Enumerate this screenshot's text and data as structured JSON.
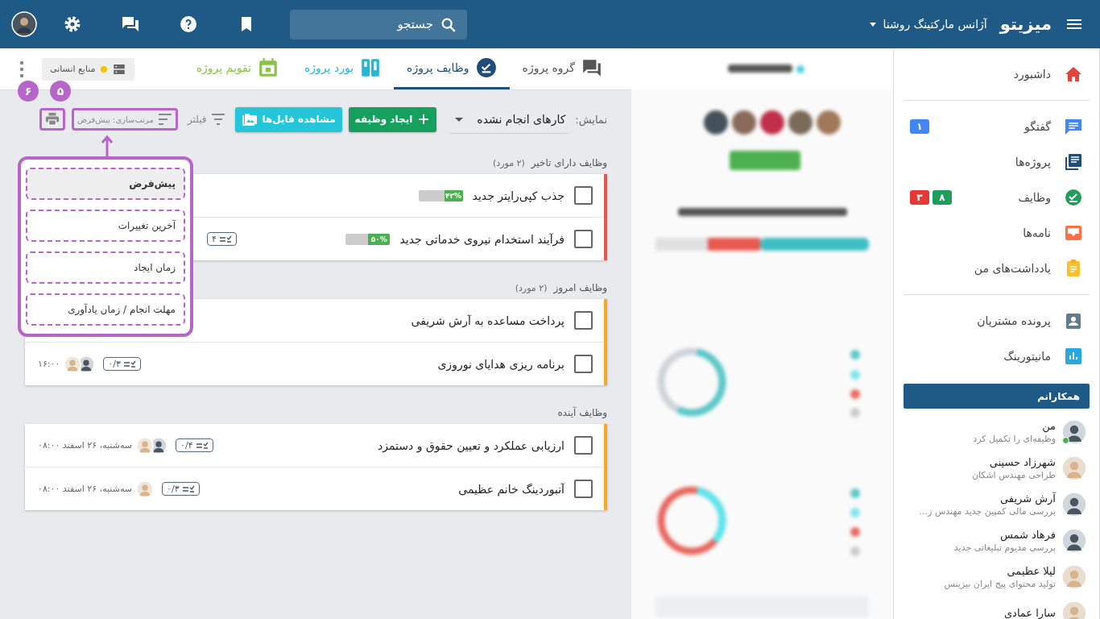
{
  "topbar": {
    "logo": "میزیتو",
    "organization": "آژانس مارکتینگ روشنا",
    "search": {
      "placeholder": "جستجو"
    }
  },
  "tabs": [
    {
      "label": "گروه پروژه",
      "selected": false,
      "color": "#555555"
    },
    {
      "label": "وظایف پروژه",
      "selected": true,
      "color": "#1f4e79"
    },
    {
      "label": "بورد پروژه",
      "selected": false,
      "color": "#26b5d4"
    },
    {
      "label": "تقویم پروژه",
      "selected": false,
      "color": "#8bc34a"
    }
  ],
  "team_badge": {
    "label": "منابع انسانی",
    "color": "#f5c400"
  },
  "toolbar": {
    "view_label": "نمایش:",
    "view_value": "کارهای انجام نشده",
    "create_button": "ایجاد وظیفه",
    "files_button": "مشاهده فایل‌ها",
    "filter": "فیلتر",
    "sort": {
      "label": "مرتب‌سازی: پیش‌فرض",
      "highlighted": true,
      "annotation": "۵"
    },
    "print": {
      "highlighted": true,
      "annotation": "۶"
    }
  },
  "sort_menu": {
    "items": [
      {
        "label": "پیش‌فرض",
        "selected": true
      },
      {
        "label": "آخرین تغییرات",
        "selected": false
      },
      {
        "label": "زمان ایجاد",
        "selected": false
      },
      {
        "label": "مهلت انجام / زمان یادآوری",
        "selected": false
      }
    ]
  },
  "groups": [
    {
      "title": "وظایف دارای تاخیر",
      "count": "(۲ مورد)",
      "color": "#e05a4f",
      "tasks": [
        {
          "title": "جذب کپی‌رایتر جدید",
          "checked": false,
          "progress": {
            "label": "۴۲%",
            "level": 0.42
          }
        },
        {
          "title": "فرآیند استخدام نیروی خدماتی جدید",
          "checked": false,
          "progress": {
            "label": "۵۰%",
            "level": 0.5
          },
          "checklist": "۴"
        }
      ]
    },
    {
      "title": "وظایف امروز",
      "count": "(۲ مورد)",
      "color": "#f9a825",
      "tasks": [
        {
          "title": "پرداخت مساعده به آرش شریفی",
          "checked": false
        },
        {
          "title": "برنامه ریزی هدایای نوروزی",
          "checked": false,
          "checklist": "۰/۳",
          "assignees": [
            {
              "kind": "man"
            },
            {
              "kind": "woman"
            }
          ],
          "due": "۱۶:۰۰"
        }
      ]
    },
    {
      "title": "وظایف آینده",
      "color": "#f9a825",
      "tasks": [
        {
          "title": "ارزیابی عملکرد و تعیین حقوق و دستمزد",
          "checked": false,
          "checklist": "۰/۴",
          "assignees": [
            {
              "kind": "man"
            },
            {
              "kind": "woman"
            }
          ],
          "due": "سه‌شنبه، ۲۶ اسفند ۰۸:۰۰"
        },
        {
          "title": "آنبوردینگ خانم عظیمی",
          "checked": false,
          "checklist": "۰/۳",
          "assignees": [
            {
              "kind": "woman"
            }
          ],
          "due": "سه‌شنبه، ۲۶ اسفند ۰۸:۰۰"
        }
      ]
    }
  ],
  "sidebar": {
    "nav_groups": [
      {
        "items": [
          {
            "label": "داشبورد"
          }
        ]
      },
      {
        "items": [
          {
            "label": "گفتگو",
            "badges": [
              {
                "text": "۱",
                "color": "#4285f4"
              }
            ]
          },
          {
            "label": "پروژه‌ها"
          },
          {
            "label": "وظایف",
            "badges": [
              {
                "text": "۸",
                "color": "#1e9e5a"
              },
              {
                "text": "۳",
                "color": "#e53935"
              }
            ]
          },
          {
            "label": "نامه‌ها"
          },
          {
            "label": "یادداشت‌های من"
          }
        ]
      },
      {
        "items": [
          {
            "label": "پرونده مشتریان"
          },
          {
            "label": "مانیتورینگ"
          }
        ]
      }
    ],
    "colleagues_title": "همکارانم",
    "colleagues": [
      {
        "name": "من",
        "status": "وظیفه‌ای را تکمیل کرد",
        "online": true,
        "kind": "man"
      },
      {
        "name": "شهرزاد حسینی",
        "status": "طراحی مهندس اشکان",
        "online": false,
        "kind": "woman"
      },
      {
        "name": "آرش شریفی",
        "status": "بررسی مالی کمپین جدید مهندس ز...",
        "online": false,
        "kind": "man"
      },
      {
        "name": "فرهاد شمس",
        "status": "بررسی مدیوم تبلیغاتی جدید",
        "online": false,
        "kind": "man"
      },
      {
        "name": "لیلا عظیمی",
        "status": "تولید محتوای پیج ایران بیزینس",
        "online": false,
        "kind": "woman"
      },
      {
        "name": "سارا عمادی",
        "online": false,
        "kind": "woman"
      }
    ]
  }
}
